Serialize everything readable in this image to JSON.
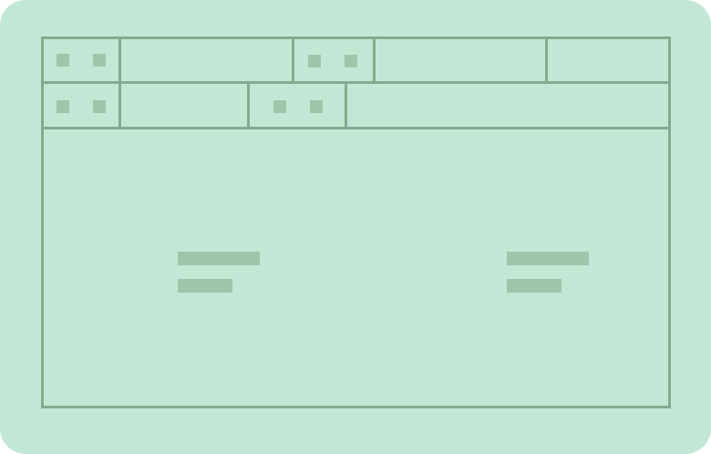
{
  "wireframe": {
    "header_row_1": [
      "icon-pair",
      "field",
      "icon-pair",
      "field",
      "field"
    ],
    "header_row_2": [
      "icon-pair",
      "field",
      "icon-pair",
      "field"
    ],
    "body_blocks": 2
  },
  "colors": {
    "background": "#c2e8d5",
    "border": "#86a98e",
    "placeholder": "#9fc6aa"
  }
}
